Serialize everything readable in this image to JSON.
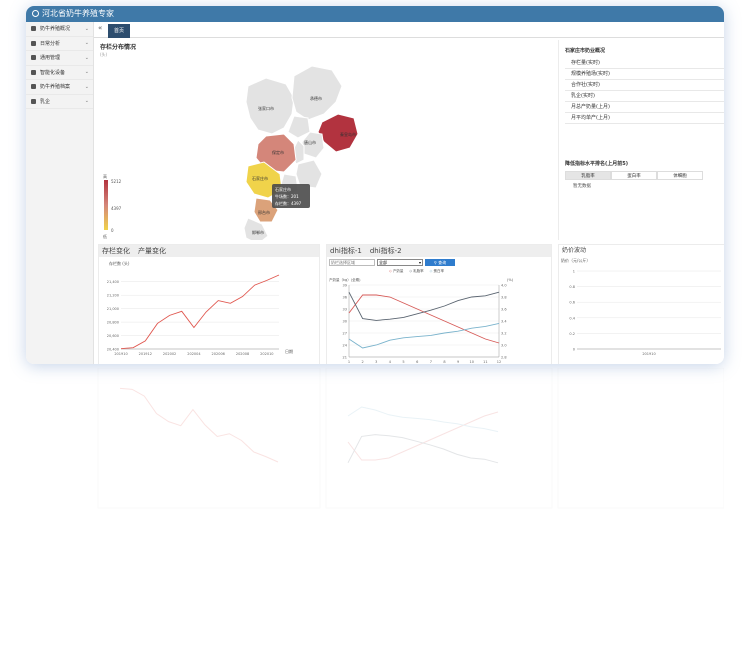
{
  "app": {
    "title": "河北省奶牛养殖专家"
  },
  "sidebar": {
    "items": [
      {
        "label": "奶牛养殖概况"
      },
      {
        "label": "日常分析"
      },
      {
        "label": "通用管理"
      },
      {
        "label": "智能化设备"
      },
      {
        "label": "奶牛养殖档案"
      },
      {
        "label": "乳企"
      }
    ]
  },
  "tabbar": {
    "toggle": "«",
    "home": "首页"
  },
  "map": {
    "title": "存栏分布情况",
    "unit": "(头)",
    "legend_max": "5212",
    "legend_mid": "4397",
    "legend_min": "0",
    "legend_high": "高",
    "legend_low": "低",
    "cities": [
      {
        "name": "张家口市"
      },
      {
        "name": "承德市"
      },
      {
        "name": "秦皇岛市"
      },
      {
        "name": "唐山市"
      },
      {
        "name": "保定市"
      },
      {
        "name": "石家庄市"
      },
      {
        "name": "邢台市"
      },
      {
        "name": "邯郸市"
      }
    ],
    "tooltip": {
      "title": "石家庄市",
      "line1": "牛场数：201",
      "line2": "存栏数：4397"
    },
    "colors": {
      "high": "#b2333f",
      "mid": "#d4867a",
      "low": "#f0d34a"
    }
  },
  "info": {
    "title": "石家庄市奶业概况",
    "rows": [
      "存栏量(实时)",
      "规模养殖场(实时)",
      "合作社(实时)",
      "乳企(实时)",
      "月总产奶量(上月)",
      "月平均单产(上月)"
    ],
    "rank_title": "降低指标水平排名(上月前5)",
    "rank_tabs": [
      "乳脂率",
      "蛋白率",
      "体细胞"
    ],
    "empty": "暂无数据"
  },
  "chart1": {
    "tabs": [
      "存栏变化",
      "产量变化"
    ],
    "unit": "存栏数 (头)",
    "xunit": "日期"
  },
  "chart2": {
    "tabs": [
      "dhi指标-1",
      "dhi指标-2"
    ],
    "search_placeholder": "奶栏选择区域",
    "select_value": "全部",
    "query_label": "查询",
    "left_unit": "产奶量（kg）(全期)",
    "right_unit": "(%)",
    "legend": [
      "产奶量",
      "乳脂率",
      "蛋白率"
    ]
  },
  "chart3": {
    "title": "奶价波动",
    "unit": "奶价（元/公斤）"
  },
  "chart_data": [
    {
      "type": "line",
      "title": "存栏变化",
      "ylabel": "存栏数 (头)",
      "xlabel": "日期",
      "ylim": [
        20400,
        21500
      ],
      "yticks": [
        20400,
        20600,
        20800,
        21000,
        21200,
        21400
      ],
      "x": [
        "201910",
        "201911",
        "201912",
        "202001",
        "202002",
        "202003",
        "202004",
        "202005",
        "202006",
        "202007",
        "202008",
        "202009",
        "202010",
        "202011"
      ],
      "xtick_labels": [
        "201910",
        "201912",
        "202002",
        "202004",
        "202006",
        "202008",
        "202010"
      ],
      "series": [
        {
          "values": [
            20405,
            20420,
            20520,
            20780,
            20900,
            20960,
            20720,
            20950,
            21120,
            21080,
            21180,
            21350,
            21420,
            21500
          ],
          "color": "#e0574f"
        }
      ]
    },
    {
      "type": "line",
      "title": "dhi指标-1",
      "ylabel": "产奶量（kg）(全期)",
      "y2label": "(%)",
      "ylim": [
        21,
        39
      ],
      "yticks": [
        21,
        24,
        27,
        30,
        33,
        36,
        39
      ],
      "y2lim": [
        2.8,
        4.0
      ],
      "y2ticks": [
        2.8,
        3.0,
        3.2,
        3.4,
        3.6,
        3.8,
        4.0
      ],
      "x": [
        1,
        2,
        3,
        4,
        5,
        6,
        7,
        8,
        9,
        10,
        11,
        12
      ],
      "series": [
        {
          "name": "产奶量",
          "values": [
            32,
            36.5,
            36.5,
            36,
            34.5,
            33,
            31.5,
            30,
            28.5,
            27,
            25.5,
            24.5
          ],
          "color": "#d65a57"
        },
        {
          "name": "乳脂率",
          "values": [
            3.88,
            3.44,
            3.41,
            3.43,
            3.46,
            3.52,
            3.58,
            3.65,
            3.74,
            3.8,
            3.82,
            3.88
          ],
          "color": "#5a6470"
        },
        {
          "name": "蛋白率",
          "values": [
            3.1,
            2.95,
            3.0,
            3.08,
            3.12,
            3.14,
            3.16,
            3.2,
            3.23,
            3.28,
            3.31,
            3.36
          ],
          "color": "#7ab3cc"
        }
      ]
    },
    {
      "type": "line",
      "title": "奶价波动",
      "ylabel": "奶价（元/公斤）",
      "ylim": [
        0,
        1
      ],
      "yticks": [
        0,
        0.2,
        0.4,
        0.6,
        0.8,
        1
      ],
      "x": [
        "201910"
      ],
      "series": []
    }
  ]
}
